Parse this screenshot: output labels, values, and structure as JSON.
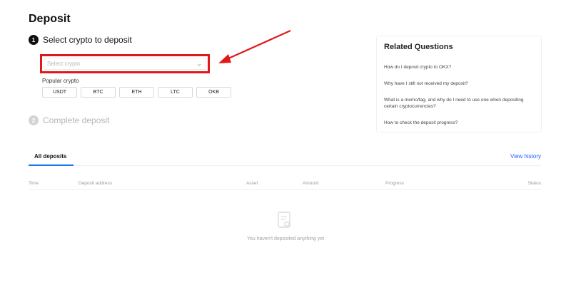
{
  "title": "Deposit",
  "steps": [
    {
      "number": "1",
      "label": "Select crypto to deposit"
    },
    {
      "number": "2",
      "label": "Complete deposit"
    }
  ],
  "select": {
    "placeholder": "Select crypto"
  },
  "popular": {
    "label": "Popular crypto",
    "coins": [
      "USDT",
      "BTC",
      "ETH",
      "LTC",
      "OKB"
    ]
  },
  "related": {
    "title": "Related Questions",
    "questions": [
      "How do I deposit crypto to OKX?",
      "Why have I still not received my deposit?",
      "What is a memo/tag, and why do I need to use one when depositing certain cryptocurrencies?",
      "How to check the deposit progress?"
    ]
  },
  "tabs": {
    "all_deposits": "All deposits",
    "view_history": "View history"
  },
  "table": {
    "columns": [
      "Time",
      "Deposit address",
      "Asset",
      "Amount",
      "Progress",
      "Status"
    ]
  },
  "empty": {
    "text": "You haven't deposited anything yet"
  },
  "colors": {
    "highlight": "#e21818",
    "link": "#1f5fff",
    "tab_underline": "#1a73e8"
  }
}
